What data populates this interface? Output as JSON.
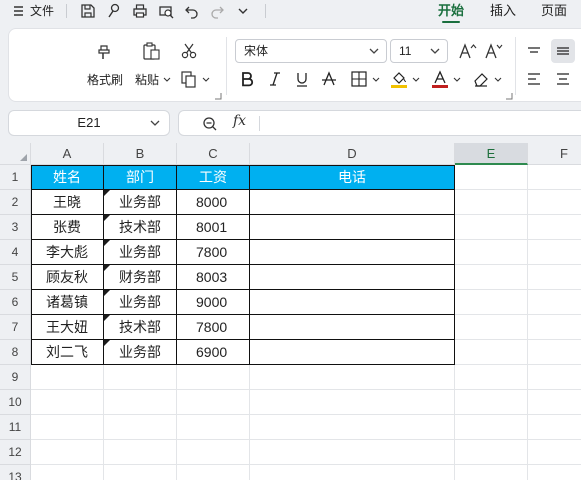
{
  "menu": {
    "file_label": "文件",
    "tabs": [
      {
        "label": "开始",
        "active": true
      },
      {
        "label": "插入",
        "active": false
      },
      {
        "label": "页面",
        "active": false
      }
    ]
  },
  "ribbon": {
    "format_painter_label": "格式刷",
    "paste_label": "粘贴",
    "font_name": "宋体",
    "font_size": "11"
  },
  "formula_bar": {
    "name_box": "E21",
    "fx_label": "fx",
    "formula": ""
  },
  "sheet": {
    "columns": [
      "A",
      "B",
      "C",
      "D",
      "E",
      "F"
    ],
    "selected_column": "E",
    "rows": [
      "1",
      "2",
      "3",
      "4",
      "5",
      "6",
      "7",
      "8",
      "9",
      "10",
      "11",
      "12",
      "13"
    ],
    "headers": [
      "姓名",
      "部门",
      "工资",
      "电话"
    ],
    "records": [
      {
        "name": "王晓",
        "dept": "业务部",
        "salary": "8000",
        "phone": ""
      },
      {
        "name": "张费",
        "dept": "技术部",
        "salary": "8001",
        "phone": ""
      },
      {
        "name": "李大彪",
        "dept": "业务部",
        "salary": "7800",
        "phone": ""
      },
      {
        "name": "顾友秋",
        "dept": "财务部",
        "salary": "8003",
        "phone": ""
      },
      {
        "name": "诸葛镇",
        "dept": "业务部",
        "salary": "9000",
        "phone": ""
      },
      {
        "name": "王大妞",
        "dept": "技术部",
        "salary": "7800",
        "phone": ""
      },
      {
        "name": "刘二飞",
        "dept": "业务部",
        "salary": "6900",
        "phone": ""
      }
    ],
    "header_fill": "#00b0f0",
    "accent": "#1a6f3e"
  }
}
